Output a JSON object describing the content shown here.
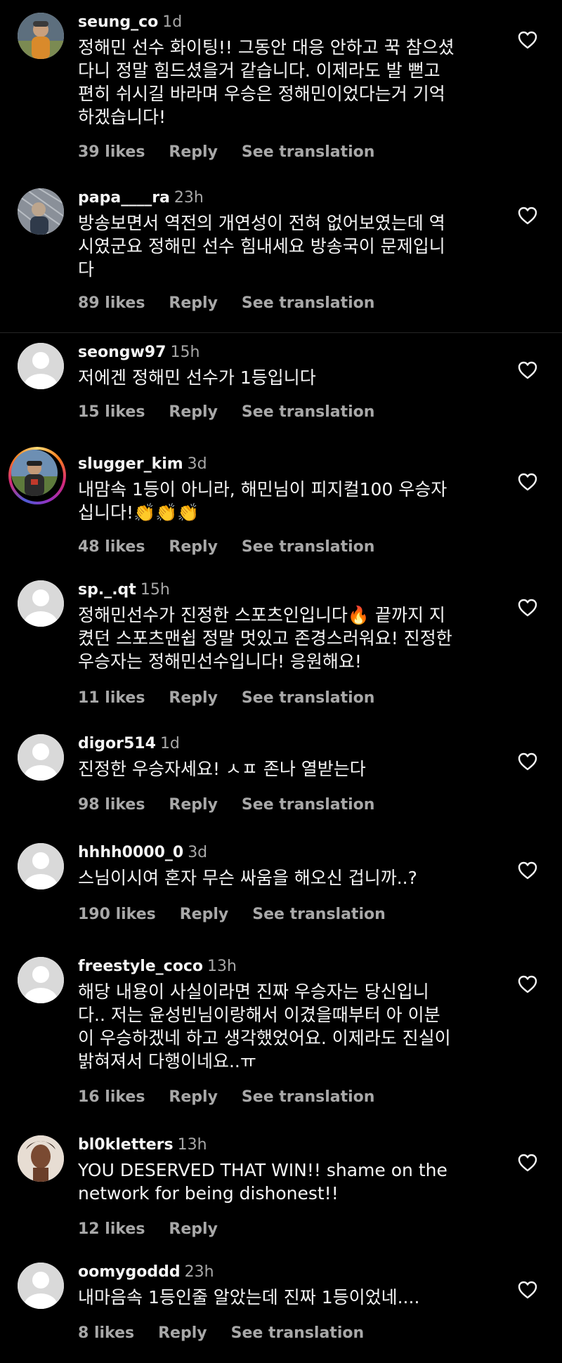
{
  "comments": [
    {
      "username": "seung_co",
      "time": "1d",
      "text": "정해민 선수 화이팅!! 그동안 대응 안하고 꾹 참으셨\n다니 정말 힘드셨을거 같습니다. 이제라도 발 뻗고\n편히 쉬시길 바라며 우승은 정해민이었다는거 기억\n하겠습니다!",
      "likes": "39 likes",
      "reply": "Reply",
      "translation": "See translation",
      "avatar": "photo"
    },
    {
      "username": "papa____ra",
      "time": "23h",
      "text": "방송보면서 역전의 개연성이 전혀 없어보였는데 역\n시였군요 정해민 선수 힘내세요 방송국이 문제입니\n다",
      "likes": "89 likes",
      "reply": "Reply",
      "translation": "See translation",
      "avatar": "photo"
    },
    {
      "username": "seongw97",
      "time": "15h",
      "text": "저에겐 정해민 선수가 1등입니다",
      "likes": "15 likes",
      "reply": "Reply",
      "translation": "See translation",
      "avatar": "default"
    },
    {
      "username": "slugger_kim",
      "time": "3d",
      "text": "내맘속 1등이 아니라, 해민님이 피지컬100 우승자\n십니다!👏👏👏",
      "likes": "48 likes",
      "reply": "Reply",
      "translation": "See translation",
      "avatar": "story"
    },
    {
      "username": "sp._.qt",
      "time": "15h",
      "text": "정해민선수가 진정한 스포츠인입니다🔥 끝까지 지\n켰던 스포츠맨쉽 정말 멋있고 존경스러워요! 진정한\n우승자는 정해민선수입니다! 응원해요!",
      "likes": "11 likes",
      "reply": "Reply",
      "translation": "See translation",
      "avatar": "default"
    },
    {
      "username": "digor514",
      "time": "1d",
      "text": "진정한 우승자세요! ㅅㅍ 존나 열받는다",
      "likes": "98 likes",
      "reply": "Reply",
      "translation": "See translation",
      "avatar": "default"
    },
    {
      "username": "hhhh0000_0",
      "time": "3d",
      "text": "스님이시여 혼자 무슨 싸움을 해오신 겁니까..?",
      "likes": "190 likes",
      "reply": "Reply",
      "translation": "See translation",
      "avatar": "default"
    },
    {
      "username": "freestyle_coco",
      "time": "13h",
      "text": "해당 내용이 사실이라면 진짜 우승자는 당신입니\n다.. 저는 윤성빈님이랑해서 이겼을때부터 아 이분\n이 우승하겠네 하고 생각했었어요. 이제라도 진실이\n밝혀져서 다행이네요..ㅠ",
      "likes": "16 likes",
      "reply": "Reply",
      "translation": "See translation",
      "avatar": "default"
    },
    {
      "username": "bl0kletters",
      "time": "13h",
      "text": "YOU DESERVED THAT WIN!! shame on the\nnetwork for being dishonest!!",
      "likes": "12 likes",
      "reply": "Reply",
      "translation": "",
      "avatar": "photo"
    },
    {
      "username": "oomygoddd",
      "time": "23h",
      "text": "내마음속 1등인줄 알았는데 진짜 1등이었네....",
      "likes": "8 likes",
      "reply": "Reply",
      "translation": "See translation",
      "avatar": "default"
    }
  ],
  "colors": {
    "background": "#000000",
    "primary_text": "#f5f5f5",
    "secondary_text": "#a8a8a8",
    "divider": "#262626",
    "default_avatar": "#d9d9d9"
  }
}
